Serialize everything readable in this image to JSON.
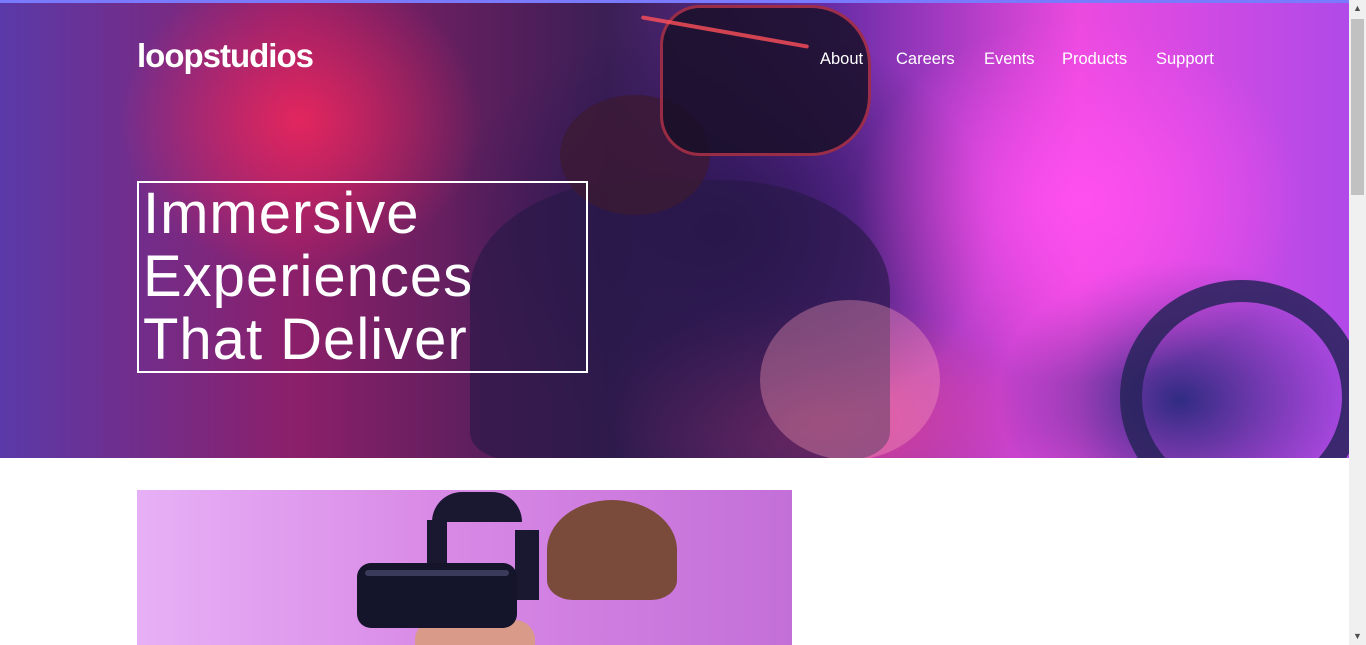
{
  "header": {
    "logo": "loopstudios",
    "nav": [
      {
        "label": "About"
      },
      {
        "label": "Careers"
      },
      {
        "label": "Events"
      },
      {
        "label": "Products"
      },
      {
        "label": "Support"
      }
    ]
  },
  "hero": {
    "headline_lines": [
      "Immersive",
      "Experiences",
      "That Deliver"
    ]
  },
  "scrollbar": {
    "up_icon": "▲",
    "down_icon": "▼"
  }
}
